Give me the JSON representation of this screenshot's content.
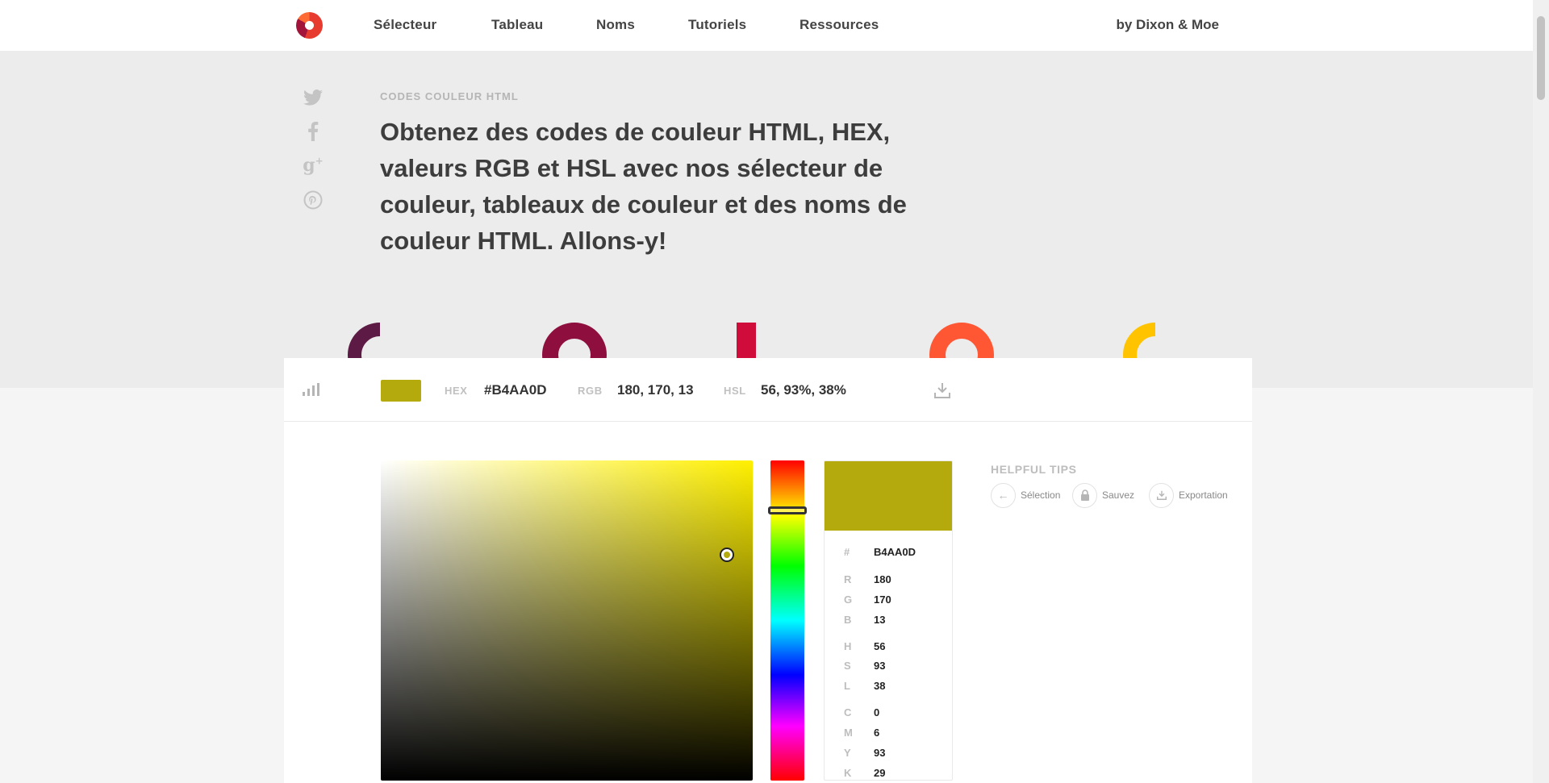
{
  "nav": {
    "links": [
      "Sélecteur",
      "Tableau",
      "Noms",
      "Tutoriels",
      "Ressources"
    ],
    "byline": "by Dixon & Moe"
  },
  "hero": {
    "eyebrow": "CODES COULEUR HTML",
    "headline": "Obtenez des codes de couleur HTML, HEX, valeurs RGB et HSL avec nos sélecteur de couleur, tableaux de couleur et des noms de couleur HTML. Allons-y!",
    "social_icons": [
      "twitter-icon",
      "facebook-icon",
      "google-plus-icon",
      "pinterest-icon"
    ],
    "deco_colors": [
      "#5c1a44",
      "#8e0e3d",
      "#d00c3b",
      "#ff5733",
      "#ffc300"
    ]
  },
  "toolbar": {
    "hex_label": "HEX",
    "hex_value": "#B4AA0D",
    "rgb_label": "RGB",
    "rgb_value": "180, 170, 13",
    "hsl_label": "HSL",
    "hsl_value": "56, 93%, 38%"
  },
  "color": {
    "current": "#b4aa0d",
    "hue_base": "#fff000",
    "hue_position": 0.156,
    "saturation_position": 0.93,
    "value_position": 0.706
  },
  "values": {
    "hash_label": "#",
    "hex": "B4AA0D",
    "r_label": "R",
    "r": "180",
    "g_label": "G",
    "g": "170",
    "b_label": "B",
    "b": "13",
    "h_label": "H",
    "h": "56",
    "s_label": "S",
    "s": "93",
    "l_label": "L",
    "l": "38",
    "c_label": "C",
    "c": "0",
    "m_label": "M",
    "m": "6",
    "y_label": "Y",
    "y": "93",
    "k_label": "K",
    "k": "29"
  },
  "tips": {
    "title": "HELPFUL TIPS",
    "items": [
      "Sélection",
      "Sauvez",
      "Exportation"
    ]
  }
}
